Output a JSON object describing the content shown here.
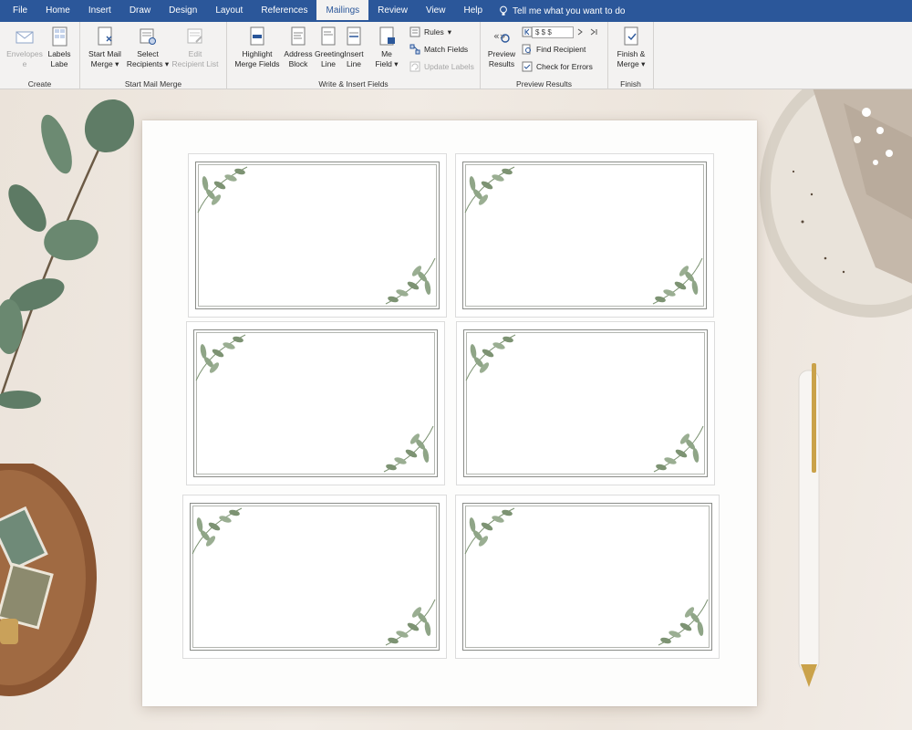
{
  "tabs": [
    {
      "label": "File"
    },
    {
      "label": "Home"
    },
    {
      "label": "Insert"
    },
    {
      "label": "Draw"
    },
    {
      "label": "Design"
    },
    {
      "label": "Layout"
    },
    {
      "label": "References"
    },
    {
      "label": "Mailings",
      "active": true
    },
    {
      "label": "Review"
    },
    {
      "label": "View"
    },
    {
      "label": "Help"
    }
  ],
  "tell_me": "Tell me what you want to do",
  "groups": {
    "create": {
      "label": "Create",
      "envelopes": "Envelopes",
      "labels": "Labels"
    },
    "start": {
      "label": "Start Mail Merge",
      "start_mail_merge": "Start Mail",
      "start_mail_merge2": "Merge",
      "select_recipients": "Select",
      "select_recipients2": "Recipients",
      "edit_recipient_list": "Edit",
      "edit_recipient_list2": "Recipient List"
    },
    "write": {
      "label": "Write & Insert Fields",
      "highlight": "Highlight",
      "highlight2": "Merge Fields",
      "address_block": "Address",
      "address_block2": "Block",
      "greeting_line": "Greeting",
      "greeting_line2": "Line",
      "insert_line": "Insert",
      "insert_line2": "Line",
      "insert_merge_field": "Me",
      "insert_merge_field2": "Field",
      "rules": "Rules",
      "match_fields": "Match Fields",
      "update_labels": "Update Labels"
    },
    "preview": {
      "label": "Preview Results",
      "preview_results": "Preview",
      "preview_results2": "Results",
      "record": "$ $ $",
      "find_recipient": "Find Recipient",
      "check_errors": "Check for Errors"
    },
    "finish": {
      "label": "Finish",
      "finish_merge": "Finish &",
      "finish_merge2": "Merge"
    }
  },
  "colors": {
    "ribbon_blue": "#2b579a",
    "ribbon_bg": "#f3f2f1",
    "desk": "#eee6de",
    "leaf": "#7d9373"
  }
}
